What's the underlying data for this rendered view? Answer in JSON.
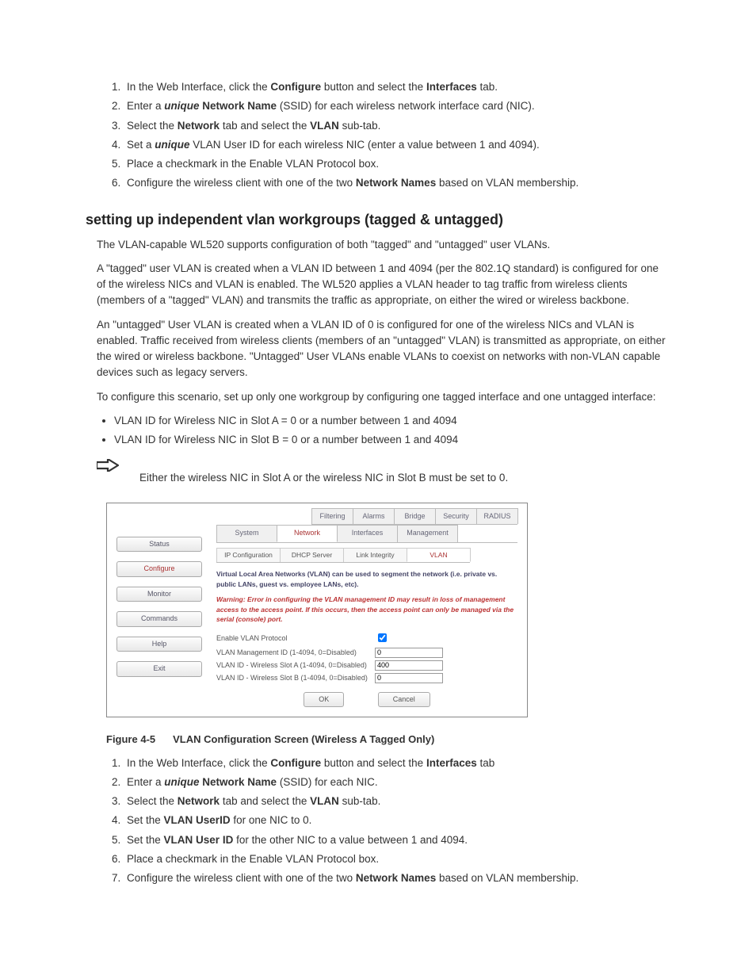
{
  "list1": {
    "i1": {
      "pre": "In the Web Interface, click the ",
      "b1": "Configure",
      "mid": " button and select the ",
      "b2": "Interfaces",
      "post": " tab."
    },
    "i2": {
      "pre": "Enter a ",
      "bi": "unique",
      "b": " Network Name",
      "post": " (SSID) for each wireless network interface card (NIC)."
    },
    "i3": {
      "pre": "Select the ",
      "b1": "Network",
      "mid": " tab and select the ",
      "b2": "VLAN",
      "post": " sub-tab."
    },
    "i4": {
      "pre": "Set a ",
      "bi": "unique",
      "post": " VLAN User ID for each wireless NIC (enter a value between 1 and 4094)."
    },
    "i5": "Place a checkmark in the Enable VLAN Protocol box.",
    "i6": {
      "pre": "Configure the wireless client with one of the two ",
      "b": "Network Names",
      "post": " based on VLAN membership."
    }
  },
  "section_heading": "setting up independent vlan workgroups (tagged & untagged)",
  "para1": "The VLAN-capable WL520 supports configuration of both \"tagged\" and \"untagged\" user VLANs.",
  "para2": "A \"tagged\" user VLAN is created when a VLAN ID between 1 and 4094 (per the 802.1Q standard) is configured for one of the wireless NICs and VLAN is enabled. The WL520 applies a VLAN header to tag traffic from wireless clients (members of a \"tagged\" VLAN) and transmits the traffic as appropriate, on either the wired or wireless backbone.",
  "para3": "An \"untagged\" User VLAN is created when a VLAN ID of 0 is configured for one of the wireless NICs and VLAN is enabled. Traffic received from wireless clients (members of an \"untagged\" VLAN) is transmitted as appropriate, on either the wired or wireless backbone. \"Untagged\" User VLANs enable VLANs to coexist on networks with non-VLAN capable devices such as legacy servers.",
  "para4": "To configure this scenario, set up only one workgroup by configuring one tagged interface and one untagged interface:",
  "bullets": {
    "b1": "VLAN ID for Wireless NIC in Slot A = 0 or a number between 1 and 4094",
    "b2": "VLAN ID for Wireless NIC in Slot B = 0 or a number between 1 and 4094"
  },
  "note": "Either the wireless NIC in Slot A or the wireless NIC in Slot B must be set to 0.",
  "fig": {
    "tabs_top": [
      "Filtering",
      "Alarms",
      "Bridge",
      "Security",
      "RADIUS"
    ],
    "tabs_bottom": [
      "System",
      "Network",
      "Interfaces",
      "Management"
    ],
    "active_bottom": "Network",
    "subtabs": [
      "IP Configuration",
      "DHCP Server",
      "Link Integrity",
      "VLAN"
    ],
    "active_sub": "VLAN",
    "nav": [
      "Status",
      "Configure",
      "Monitor",
      "Commands",
      "Help",
      "Exit"
    ],
    "active_nav": "Configure",
    "desc": "Virtual Local Area Networks (VLAN) can be used to segment the network (i.e. private vs. public LANs, guest vs. employee LANs, etc).",
    "warn": "Warning: Error in configuring the VLAN management ID may result in loss of management access to the access point. If this occurs, then the access point can only be managed via the serial (console) port.",
    "rows": {
      "r1": "Enable VLAN Protocol",
      "r2": "VLAN Management ID (1-4094, 0=Disabled)",
      "r3": "VLAN ID - Wireless Slot A (1-4094, 0=Disabled)",
      "r4": "VLAN ID - Wireless Slot B (1-4094, 0=Disabled)"
    },
    "vals": {
      "v2": "0",
      "v3": "400",
      "v4": "0"
    },
    "ok": "OK",
    "cancel": "Cancel"
  },
  "caption": {
    "num": "Figure 4-5",
    "txt": "VLAN Configuration Screen (Wireless A Tagged Only)"
  },
  "list2": {
    "i1": {
      "pre": "In the Web Interface, click the ",
      "b1": "Configure",
      "mid": " button and select the ",
      "b2": "Interfaces",
      "post": " tab"
    },
    "i2": {
      "pre": "Enter a ",
      "bi": "unique",
      "b": " Network Name",
      "post": " (SSID) for each NIC."
    },
    "i3": {
      "pre": "Select the ",
      "b1": "Network",
      "mid": " tab and select the ",
      "b2": "VLAN",
      "post": " sub-tab."
    },
    "i4": {
      "pre": "Set the ",
      "b": "VLAN UserID",
      "post": " for one NIC to 0."
    },
    "i5": {
      "pre": "Set the ",
      "b": "VLAN User ID",
      "post": " for the other NIC to a value between 1 and 4094."
    },
    "i6": "Place a checkmark in the Enable VLAN Protocol box.",
    "i7": {
      "pre": "Configure the wireless client with one of the two ",
      "b": "Network Names",
      "post": " based on VLAN membership."
    }
  }
}
